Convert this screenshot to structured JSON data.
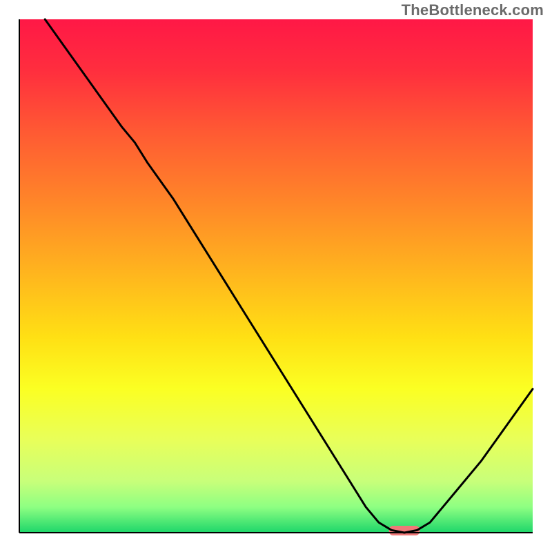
{
  "watermark": "TheBottleneck.com",
  "chart_data": {
    "type": "line",
    "title": "",
    "xlabel": "",
    "ylabel": "",
    "xlim": [
      0,
      100
    ],
    "ylim": [
      0,
      100
    ],
    "notes": "Background is a vertical red→yellow→green heatmap gradient. Y-axis is inverted visually (low values at bottom = green/good, high values at top = red/bad). No tick labels or axis labels are rendered. A short pink/red marker segment sits on the x-axis near x≈72–78.",
    "series": [
      {
        "name": "bottleneck-curve",
        "color": "#000000",
        "x": [
          5,
          10,
          15,
          20,
          22.5,
          25,
          30,
          35,
          40,
          45,
          50,
          55,
          60,
          65,
          67.5,
          70,
          72.5,
          75,
          77.5,
          80,
          82.5,
          85,
          90,
          95,
          100
        ],
        "y": [
          100,
          93,
          86,
          79,
          76,
          72,
          65,
          57,
          49,
          41,
          33,
          25,
          17,
          9,
          5,
          2,
          0.5,
          0,
          0.5,
          2,
          5,
          8,
          14,
          21,
          28
        ]
      }
    ],
    "marker": {
      "name": "optimal-point",
      "color": "#f07878",
      "x_start": 72,
      "x_end": 78,
      "y": 0
    },
    "gradient_stops_approx": [
      {
        "pct": 0,
        "color": "#ff1846"
      },
      {
        "pct": 10,
        "color": "#ff2e3e"
      },
      {
        "pct": 22,
        "color": "#ff5a33"
      },
      {
        "pct": 35,
        "color": "#ff8429"
      },
      {
        "pct": 48,
        "color": "#ffb01f"
      },
      {
        "pct": 62,
        "color": "#ffe014"
      },
      {
        "pct": 72,
        "color": "#fbff23"
      },
      {
        "pct": 82,
        "color": "#e8ff5a"
      },
      {
        "pct": 90,
        "color": "#c8ff7a"
      },
      {
        "pct": 95,
        "color": "#8eff82"
      },
      {
        "pct": 100,
        "color": "#1dd66a"
      }
    ]
  }
}
